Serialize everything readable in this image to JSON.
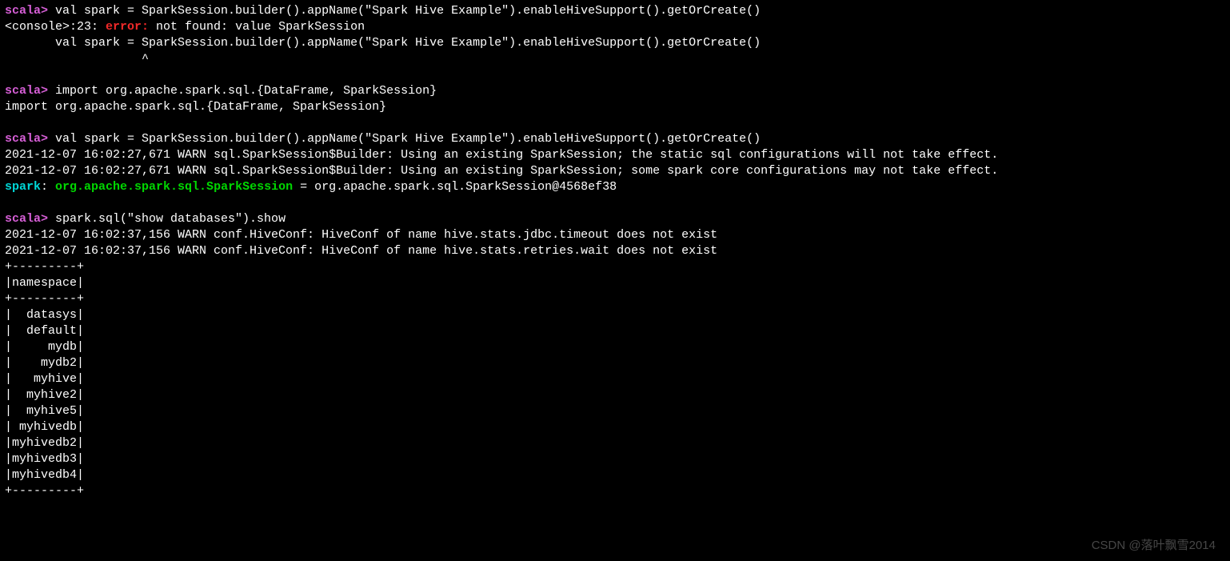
{
  "prompt_label": "scala>",
  "blocks": {
    "b1_cmd": " val spark = SparkSession.builder().appName(\"Spark Hive Example\").enableHiveSupport().getOrCreate()",
    "b1_err_pre": "<console>:23: ",
    "b1_err_word": "error: ",
    "b1_err_post": "not found: value SparkSession",
    "b1_out_line1": "       val spark = SparkSession.builder().appName(\"Spark Hive Example\").enableHiveSupport().getOrCreate()",
    "b1_out_line2": "                   ^",
    "b2_cmd": " import org.apache.spark.sql.{DataFrame, SparkSession}",
    "b2_out": "import org.apache.spark.sql.{DataFrame, SparkSession}",
    "b3_cmd": " val spark = SparkSession.builder().appName(\"Spark Hive Example\").enableHiveSupport().getOrCreate()",
    "b3_warn1": "2021-12-07 16:02:27,671 WARN sql.SparkSession$Builder: Using an existing SparkSession; the static sql configurations will not take effect.",
    "b3_warn2": "2021-12-07 16:02:27,671 WARN sql.SparkSession$Builder: Using an existing SparkSession; some spark core configurations may not take effect.",
    "b3_res_var": "spark",
    "b3_res_colon": ": ",
    "b3_res_type": "org.apache.spark.sql.SparkSession",
    "b3_res_val": " = org.apache.spark.sql.SparkSession@4568ef38",
    "b4_cmd": " spark.sql(\"show databases\").show",
    "b4_warn1": "2021-12-07 16:02:37,156 WARN conf.HiveConf: HiveConf of name hive.stats.jdbc.timeout does not exist",
    "b4_warn2": "2021-12-07 16:02:37,156 WARN conf.HiveConf: HiveConf of name hive.stats.retries.wait does not exist",
    "table_sep": "+---------+",
    "table_header": "|namespace|",
    "table_rows": [
      "|  datasys|",
      "|  default|",
      "|     mydb|",
      "|    mydb2|",
      "|   myhive|",
      "|  myhive2|",
      "|  myhive5|",
      "| myhivedb|",
      "|myhivedb2|",
      "|myhivedb3|",
      "|myhivedb4|"
    ]
  },
  "watermark": "CSDN @落叶飘雪2014"
}
